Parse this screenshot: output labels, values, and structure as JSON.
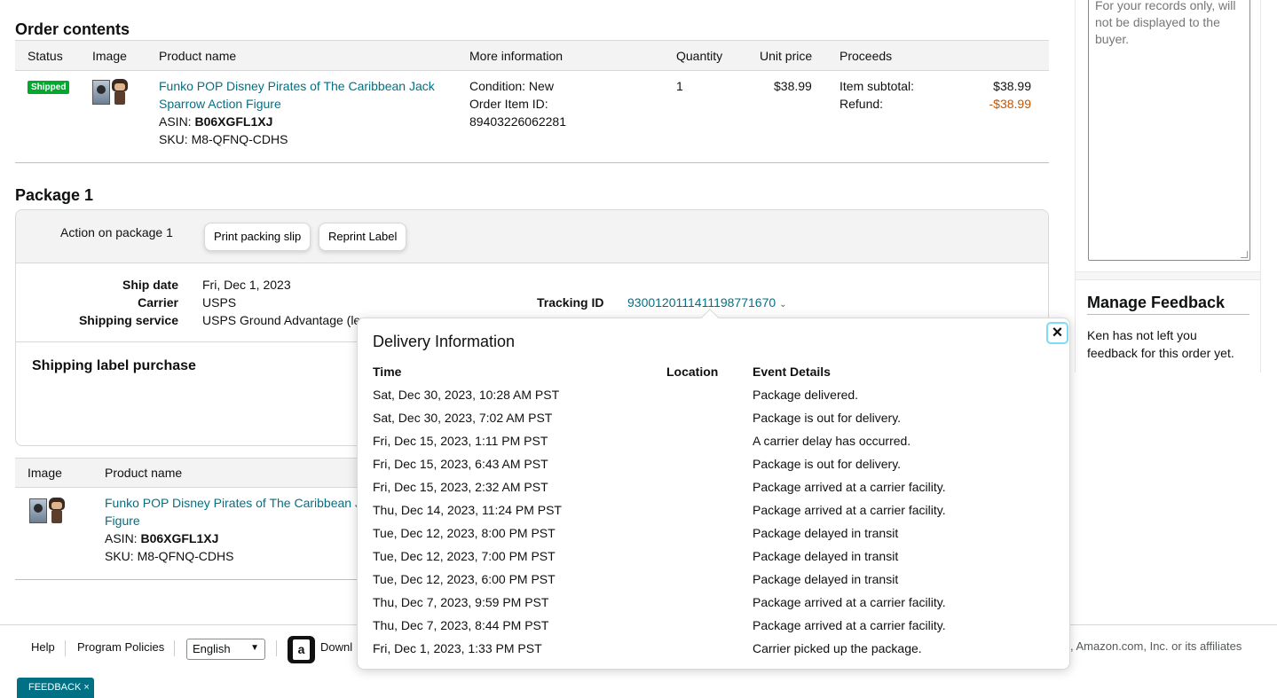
{
  "order_contents": {
    "title": "Order contents",
    "columns": [
      "Status",
      "Image",
      "Product name",
      "More information",
      "Quantity",
      "Unit price",
      "Proceeds"
    ],
    "item": {
      "status": "Shipped",
      "product_name": "Funko POP Disney Pirates of The Caribbean Jack Sparrow Action Figure",
      "product_line1": "Funko POP Disney Pirates of The Caribbean Jack",
      "product_line2": "Sparrow Action Figure",
      "asin_label": "ASIN:",
      "asin": "B06XGFL1XJ",
      "sku": "SKU: M8-QFNQ-CDHS",
      "condition": "Condition: New",
      "order_item_label": "Order Item ID:",
      "order_item_id": "89403226062281",
      "quantity": "1",
      "unit_price": "$38.99",
      "subtotal_label": "Item subtotal:",
      "subtotal": "$38.99",
      "refund_label": "Refund:",
      "refund": "-$38.99"
    }
  },
  "package": {
    "title": "Package 1",
    "action_label": "Action on package 1",
    "print_slip": "Print packing slip",
    "reprint_label": "Reprint Label",
    "ship_date_label": "Ship date",
    "ship_date": "Fri, Dec 1, 2023",
    "carrier_label": "Carrier",
    "carrier": "USPS",
    "service_label": "Shipping service",
    "service": "USPS Ground Advantage (le",
    "tracking_label": "Tracking ID",
    "tracking_id": "9300120111411198771670",
    "label_purchase_title": "Shipping label purchase"
  },
  "package_items": {
    "columns": [
      "Image",
      "Product name"
    ],
    "line1": "Funko POP Disney Pirates of The Caribbean J",
    "line2": "Figure",
    "asin_label": "ASIN:",
    "asin": "B06XGFL1XJ",
    "sku": "SKU: M8-QFNQ-CDHS"
  },
  "right_panel": {
    "notes_text": "For your records only, will not be displayed to the buyer.",
    "feedback_title": "Manage Feedback",
    "feedback_text": "Ken has not left you feedback for this order yet."
  },
  "delivery_popover": {
    "title": "Delivery Information",
    "close_icon": "close-icon",
    "columns": {
      "time": "Time",
      "location": "Location",
      "details": "Event Details"
    },
    "events": [
      {
        "time": "Sat, Dec 30, 2023, 10:28 AM PST",
        "location": "",
        "details": "Package delivered."
      },
      {
        "time": "Sat, Dec 30, 2023, 7:02 AM PST",
        "location": "",
        "details": "Package is out for delivery."
      },
      {
        "time": "Fri, Dec 15, 2023, 1:11 PM PST",
        "location": "",
        "details": "A carrier delay has occurred."
      },
      {
        "time": "Fri, Dec 15, 2023, 6:43 AM PST",
        "location": "",
        "details": "Package is out for delivery."
      },
      {
        "time": "Fri, Dec 15, 2023, 2:32 AM PST",
        "location": "",
        "details": "Package arrived at a carrier facility."
      },
      {
        "time": "Thu, Dec 14, 2023, 11:24 PM PST",
        "location": "",
        "details": "Package arrived at a carrier facility."
      },
      {
        "time": "Tue, Dec 12, 2023, 8:00 PM PST",
        "location": "",
        "details": "Package delayed in transit"
      },
      {
        "time": "Tue, Dec 12, 2023, 7:00 PM PST",
        "location": "",
        "details": "Package delayed in transit"
      },
      {
        "time": "Tue, Dec 12, 2023, 6:00 PM PST",
        "location": "",
        "details": "Package delayed in transit"
      },
      {
        "time": "Thu, Dec 7, 2023, 9:59 PM PST",
        "location": "",
        "details": "Package arrived at a carrier facility."
      },
      {
        "time": "Thu, Dec 7, 2023, 8:44 PM PST",
        "location": "",
        "details": "Package arrived at a carrier facility."
      },
      {
        "time": "Fri, Dec 1, 2023, 1:33 PM PST",
        "location": "",
        "details": "Carrier picked up the package."
      }
    ]
  },
  "footer": {
    "help": "Help",
    "program_policies": "Program Policies",
    "language": "English",
    "download_text": "Downl",
    "copyright": ", Amazon.com, Inc. or its affiliates",
    "feedback_tab": "FEEDBACK ×"
  },
  "colors": {
    "link": "#007185",
    "refund": "#c45500",
    "shipped_badge": "#00a82d",
    "feedback_tab": "#007185"
  }
}
